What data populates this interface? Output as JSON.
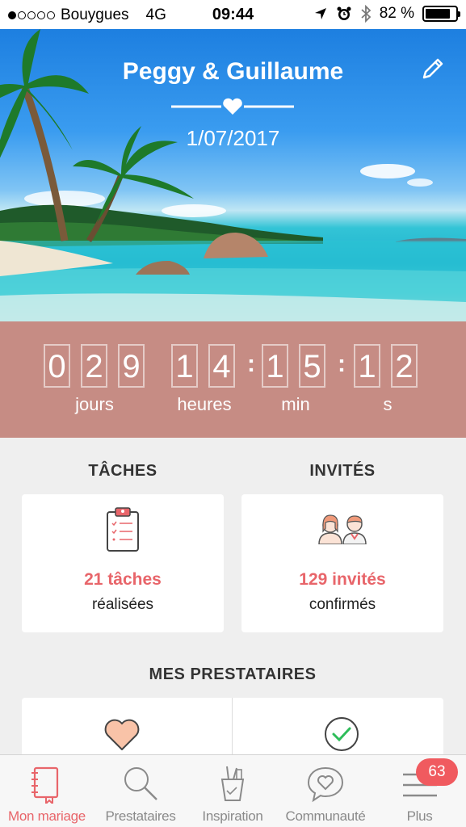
{
  "status_bar": {
    "carrier": "Bouygues",
    "network": "4G",
    "time": "09:44",
    "battery": "82 %",
    "battery_level": 0.82,
    "signal_bars": 1
  },
  "header": {
    "couple": "Peggy & Guillaume",
    "date": "1/07/2017"
  },
  "countdown": {
    "days": [
      "0",
      "2",
      "9"
    ],
    "hours": [
      "1",
      "4"
    ],
    "minutes": [
      "1",
      "5"
    ],
    "seconds": [
      "1",
      "2"
    ],
    "label_days": "jours",
    "label_hours": "heures",
    "label_minutes": "min",
    "label_seconds": "s"
  },
  "tasks": {
    "title": "TÂCHES",
    "count": "21 tâches",
    "caption": "réalisées"
  },
  "guests": {
    "title": "INVITÉS",
    "count": "129 invités",
    "caption": "confirmés"
  },
  "vendors": {
    "title": "MES PRESTATAIRES"
  },
  "tabs": [
    {
      "label": "Mon mariage",
      "icon": "notebook-icon",
      "active": true
    },
    {
      "label": "Prestataires",
      "icon": "search-icon",
      "active": false
    },
    {
      "label": "Inspiration",
      "icon": "pencil-cup-icon",
      "active": false
    },
    {
      "label": "Communauté",
      "icon": "chat-heart-icon",
      "active": false
    },
    {
      "label": "Plus",
      "icon": "menu-icon",
      "active": false,
      "badge": "63"
    }
  ],
  "colors": {
    "accent": "#e8656a",
    "countdown_bg": "#c68c84",
    "page_bg": "#efefef"
  }
}
